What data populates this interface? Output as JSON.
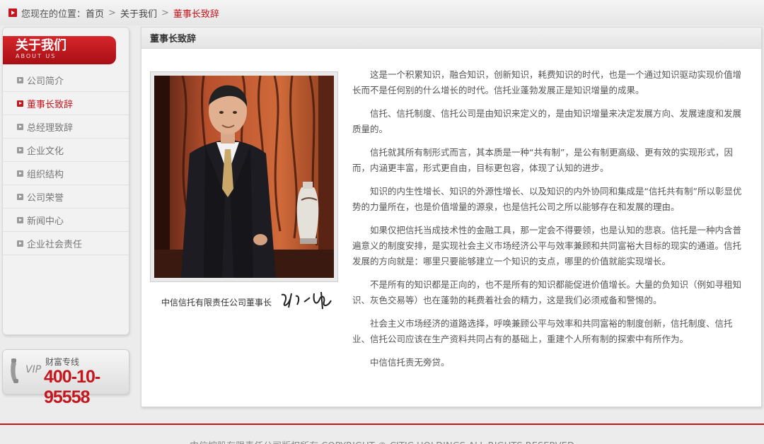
{
  "breadcrumb": {
    "prefix": "您现在的位置：",
    "home": "首页",
    "sep": ">",
    "parent": "关于我们",
    "current": "董事长致辞"
  },
  "sidebar": {
    "title": "关于我们",
    "subtitle": "ABOUT US",
    "items": [
      {
        "label": "公司简介",
        "active": false
      },
      {
        "label": "董事长致辞",
        "active": true
      },
      {
        "label": "总经理致辞",
        "active": false
      },
      {
        "label": "企业文化",
        "active": false
      },
      {
        "label": "组织结构",
        "active": false
      },
      {
        "label": "公司荣誉",
        "active": false
      },
      {
        "label": "新闻中心",
        "active": false
      },
      {
        "label": "企业社会责任",
        "active": false
      }
    ]
  },
  "hotline": {
    "vip": "VIP",
    "label": "财富专线",
    "number": "400-10-95558"
  },
  "content": {
    "title": "董事长致辞",
    "caption": "中信信托有限责任公司董事长",
    "paragraphs": [
      "这是一个积累知识，融合知识，创新知识，耗费知识的时代，也是一个通过知识驱动实现价值增长而不是任何别的什么增长的时代。信托业蓬勃发展正是知识增量的成果。",
      "信托、信托制度、信托公司是由知识来定义的，是由知识增量来决定发展方向、发展速度和发展质量的。",
      "信托就其所有制形式而言，其本质是一种“共有制”，是公有制更高级、更有效的实现形式，因而，内涵更丰富，形式更自由，目标更包容，体现了认知的进步。",
      "知识的内生性增长、知识的外源性增长、以及知识的内外协同和集成是“信托共有制”所以彰显优势的力量所在，也是价值增量的源泉，也是信托公司之所以能够存在和发展的理由。",
      "如果仅把信托当成技术性的金融工具，那一定会不得要领，也是认知的悲哀。信托是一种内含普遍意义的制度安排，是实现社会主义市场经济公平与效率兼顾和共同富裕大目标的现实的通道。信托发展的方向就是：哪里只要能够建立一个知识的支点，哪里的价值就能实现增长。",
      "不是所有的知识都是正向的，也不是所有的知识都能促进价值增长。大量的负知识（例如寻租知识、灰色交易等）也在蓬勃的耗费着社会的精力，这是我们必须戒备和警惕的。",
      "社会主义市场经济的道路选择，呼唤兼顾公平与效率和共同富裕的制度创新，信托制度、信托业、信托公司应该在生产资料共同占有的基础上，重建个人所有制的探索中有所作为。",
      "中信信托责无旁贷。"
    ]
  },
  "footer": {
    "text": "中信控股有限责任公司版权所有 COPYRIGHT © CITIC HOLDINGS ALL RIGHTS RESERVED"
  },
  "colors": {
    "accent": "#c4161c",
    "background": "#ececec"
  }
}
